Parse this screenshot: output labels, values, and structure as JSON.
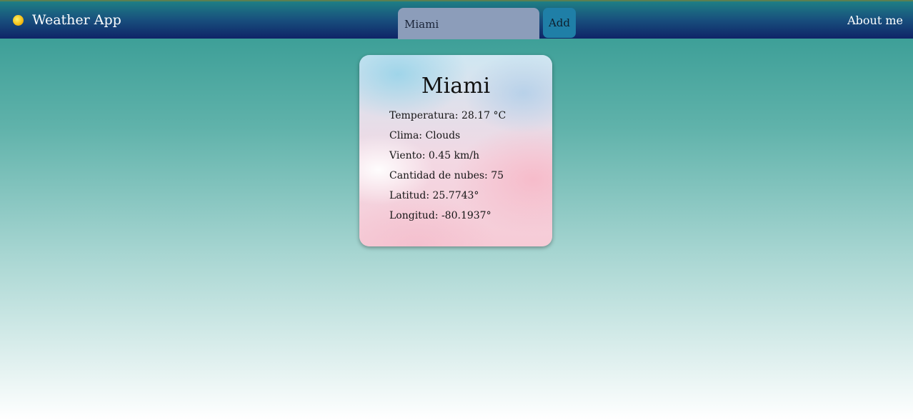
{
  "navbar": {
    "brand_icon": "sun-icon",
    "title": "Weather App",
    "search": {
      "value": "Miami",
      "placeholder": ""
    },
    "add_label": "Add",
    "about_label": "About me"
  },
  "card": {
    "city": "Miami",
    "temperature": "Temperatura: 28.17 °C",
    "weather": "Clima: Clouds",
    "wind": "Viento: 0.45 km/h",
    "clouds": "Cantidad de nubes: 75",
    "latitude": "Latitud: 25.7743°",
    "longitude": "Longitud: -80.1937°"
  },
  "colors": {
    "navbar_top": "#1e7f85",
    "navbar_bottom": "#0f2467",
    "background_top": "#2f9790",
    "background_bottom": "#ffffff",
    "add_button": "#1f7fa7",
    "search_field": "#8c9dba"
  }
}
